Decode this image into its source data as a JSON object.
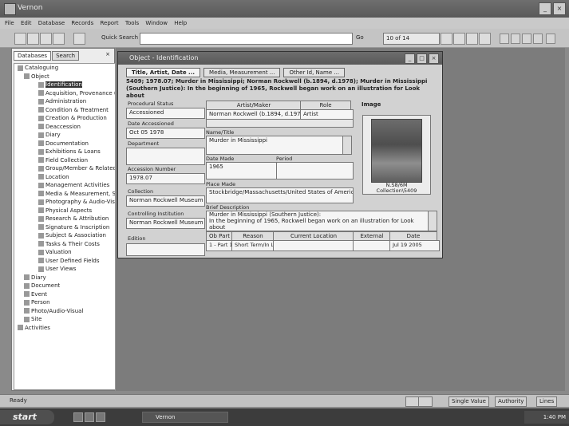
{
  "app": {
    "title": "Vernon"
  },
  "menu": [
    "File",
    "Edit",
    "Database",
    "Records",
    "Report",
    "Tools",
    "Window",
    "Help"
  ],
  "toolbar": {
    "quick_search_label": "Quick Search",
    "quick_search_value": "",
    "go_label": "Go",
    "record_label": "10",
    "record_value": "of 14"
  },
  "left_panel": {
    "tabs": [
      "Databases",
      "Search"
    ],
    "close_glyph": "×",
    "tree": [
      {
        "level": 0,
        "label": "Cataloguing",
        "selected": false
      },
      {
        "level": 1,
        "label": "Object",
        "selected": false
      },
      {
        "level": 2,
        "label": "Identification",
        "selected": true
      },
      {
        "level": 2,
        "label": "Acquisition, Provenance (",
        "selected": false
      },
      {
        "level": 2,
        "label": "Administration",
        "selected": false
      },
      {
        "level": 2,
        "label": "Condition & Treatment",
        "selected": false
      },
      {
        "level": 2,
        "label": "Creation & Production",
        "selected": false
      },
      {
        "level": 2,
        "label": "Deaccession",
        "selected": false
      },
      {
        "level": 2,
        "label": "Diary",
        "selected": false
      },
      {
        "level": 2,
        "label": "Documentation",
        "selected": false
      },
      {
        "level": 2,
        "label": "Exhibitions & Loans",
        "selected": false
      },
      {
        "level": 2,
        "label": "Field Collection",
        "selected": false
      },
      {
        "level": 2,
        "label": "Group/Member & Related",
        "selected": false
      },
      {
        "level": 2,
        "label": "Location",
        "selected": false
      },
      {
        "level": 2,
        "label": "Management Activities",
        "selected": false
      },
      {
        "level": 2,
        "label": "Media & Measurement, St",
        "selected": false
      },
      {
        "level": 2,
        "label": "Photography & Audio-Vis",
        "selected": false
      },
      {
        "level": 2,
        "label": "Physical Aspects",
        "selected": false
      },
      {
        "level": 2,
        "label": "Research & Attribution",
        "selected": false
      },
      {
        "level": 2,
        "label": "Signature & Inscription",
        "selected": false
      },
      {
        "level": 2,
        "label": "Subject & Association",
        "selected": false
      },
      {
        "level": 2,
        "label": "Tasks & Their Costs",
        "selected": false
      },
      {
        "level": 2,
        "label": "Valuation",
        "selected": false
      },
      {
        "level": 2,
        "label": "User Defined Fields",
        "selected": false
      },
      {
        "level": 2,
        "label": "User Views",
        "selected": false
      },
      {
        "level": 1,
        "label": "Diary",
        "selected": false
      },
      {
        "level": 1,
        "label": "Document",
        "selected": false
      },
      {
        "level": 1,
        "label": "Event",
        "selected": false
      },
      {
        "level": 1,
        "label": "Person",
        "selected": false
      },
      {
        "level": 1,
        "label": "Photo/Audio-Visual",
        "selected": false
      },
      {
        "level": 1,
        "label": "Site",
        "selected": false
      },
      {
        "level": 0,
        "label": "Activities",
        "selected": false
      }
    ]
  },
  "dialog": {
    "title": "Object - Identification",
    "tabs": [
      "Title, Artist, Date ...",
      "Media, Measurement ...",
      "Other Id, Name ..."
    ],
    "header": "5409; 1978.07; Murder in Mississippi; Norman Rockwell (b.1894, d.1978); Murder in Mississippi (Southern Justice): In the beginning of 1965, Rockwell began work on an illustration for Look about",
    "fields": {
      "procedural_status_label": "Procedural Status",
      "procedural_status": "Accessioned",
      "date_accessioned_label": "Date Accessioned",
      "date_accessioned": "Oct 05 1978",
      "department_label": "Department",
      "department": "",
      "accession_number_label": "Accession Number",
      "accession_number": "1978.07",
      "collection_label": "Collection",
      "collection": "Norman Rockwell Museum",
      "controlling_institution_label": "Controlling Institution",
      "controlling_institution": "Norman Rockwell Museum",
      "edition_label": "Edition",
      "edition": "",
      "artist_header": "Artist/Maker",
      "role_header": "Role",
      "artist": "Norman Rockwell (b.1894, d.1978)",
      "role": "Artist",
      "name_title_label": "Name/Title",
      "name_title": "Murder in Mississippi",
      "date_made_label": "Date Made",
      "date_made": "1965",
      "period_label": "Period",
      "period": "",
      "place_made_label": "Place Made",
      "place_made": "Stockbridge/Massachusetts/United States of America",
      "brief_description_label": "Brief Description",
      "brief_description_1": "Murder in Mississippi (Southern Justice):",
      "brief_description_2": "In the beginning of 1965, Rockwell began work on an illustration for Look about",
      "image_label": "Image",
      "image_caption_1": "N.S8/6M",
      "image_caption_2": "Collection\\5409"
    },
    "location_table": {
      "headers": [
        "Ob Part",
        "Reason",
        "Current Location",
        "External",
        "Date"
      ],
      "rows": [
        [
          "1 - Part 1",
          "Short Term/In Loan",
          "",
          "",
          "Jul 19 2005"
        ]
      ]
    }
  },
  "status_bar": {
    "text": "Ready",
    "panels": [
      "Single Value",
      "Authority",
      "Lines"
    ]
  },
  "taskbar": {
    "start": "start",
    "task": "Vernon",
    "clock": "1:40 PM"
  }
}
